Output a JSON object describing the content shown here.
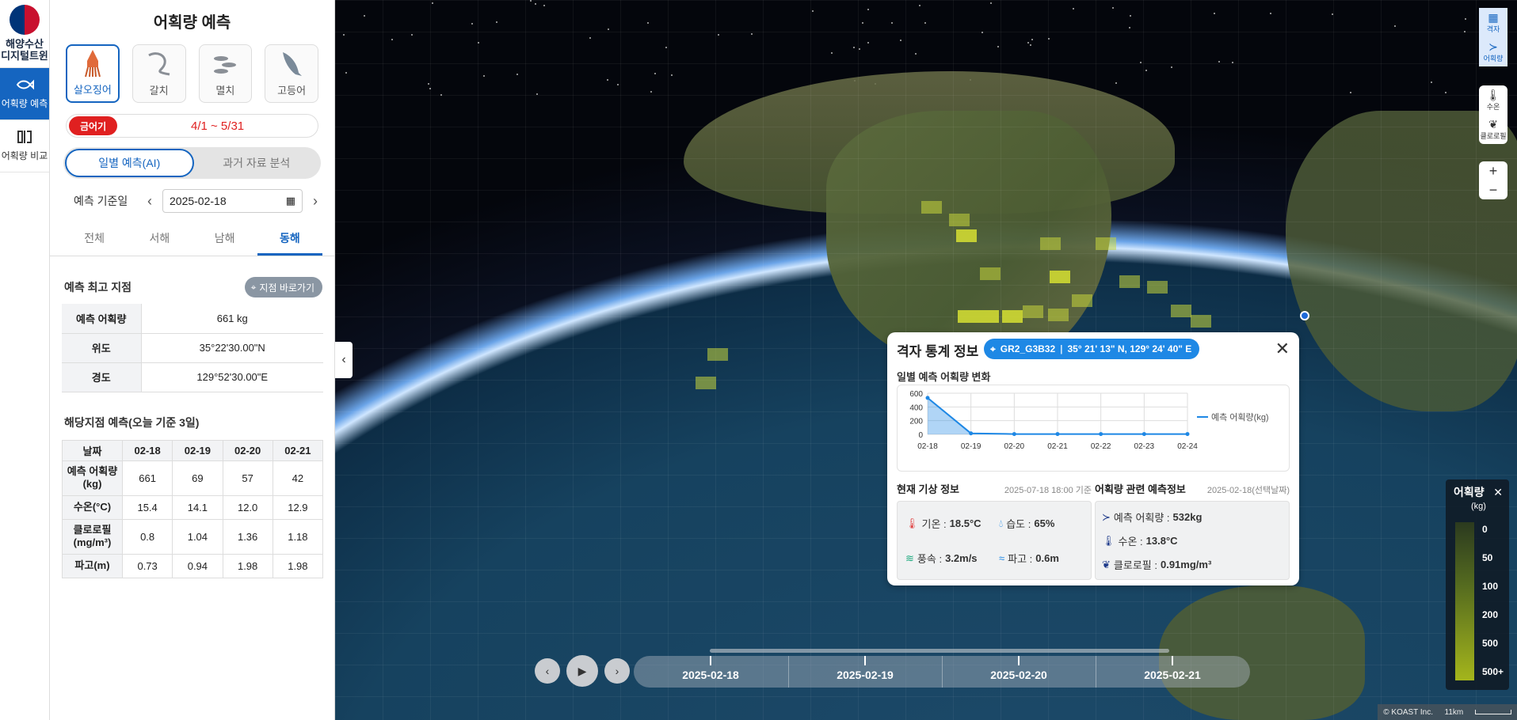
{
  "rail": {
    "logo_text": "해양수산\n디지털트윈",
    "items": [
      {
        "label": "어획량 예측",
        "icon": "fish-icon"
      },
      {
        "label": "어획량 비교",
        "icon": "compare-icon"
      }
    ]
  },
  "panel": {
    "title": "어획량 예측",
    "species": [
      {
        "label": "살오징어",
        "icon": "squid-icon",
        "active": true
      },
      {
        "label": "갈치",
        "icon": "hairtail-icon"
      },
      {
        "label": "멸치",
        "icon": "anchovy-icon"
      },
      {
        "label": "고등어",
        "icon": "mackerel-icon"
      }
    ],
    "ban": {
      "badge": "금어기",
      "range": "4/1 ~ 5/31"
    },
    "modes": [
      "일별 예측(AI)",
      "과거 자료 분석"
    ],
    "date_label": "예측 기준일",
    "date_value": "2025-02-18",
    "regions": [
      "전체",
      "서해",
      "남해",
      "동해"
    ],
    "best": {
      "heading": "예측 최고 지점",
      "goto": "지점 바로가기",
      "rows": [
        {
          "k": "예측 어획량",
          "v": "661 kg"
        },
        {
          "k": "위도",
          "v": "35°22'30.00\"N"
        },
        {
          "k": "경도",
          "v": "129°52'30.00\"E"
        }
      ]
    },
    "three": {
      "heading": "해당지점 예측(오늘 기준 3일)",
      "cols": [
        "날짜",
        "02-18",
        "02-19",
        "02-20",
        "02-21"
      ],
      "rows": [
        {
          "k": "예측 어획량\n(kg)",
          "v": [
            "661",
            "69",
            "57",
            "42"
          ]
        },
        {
          "k": "수온(°C)",
          "v": [
            "15.4",
            "14.1",
            "12.0",
            "12.9"
          ]
        },
        {
          "k": "클로로필\n(mg/m³)",
          "v": [
            "0.8",
            "1.04",
            "1.36",
            "1.18"
          ]
        },
        {
          "k": "파고(m)",
          "v": [
            "0.73",
            "0.94",
            "1.98",
            "1.98"
          ]
        }
      ]
    }
  },
  "popup": {
    "title": "격자 통계 정보",
    "grid_id": "GR2_G3B32",
    "coord": "35° 21' 13\" N, 129° 24' 40\" E",
    "chart_title": "일별 예측 어획량 변화",
    "weather": {
      "title": "현재 기상 정보",
      "time": "2025-07-18 18:00 기준",
      "temp": {
        "label": "기온 :",
        "value": "18.5°C"
      },
      "humid": {
        "label": "습도 :",
        "value": "65%"
      },
      "wind": {
        "label": "풍속 :",
        "value": "3.2m/s"
      },
      "wave": {
        "label": "파고 :",
        "value": "0.6m"
      }
    },
    "forecast": {
      "title": "어획량 관련 예측정보",
      "date": "2025-02-18(선택날짜)",
      "catch": {
        "label": "예측 어획량 :",
        "value": "532kg"
      },
      "sst": {
        "label": "수온 :",
        "value": "13.8°C"
      },
      "chl": {
        "label": "클로로필 :",
        "value": "0.91mg/m³"
      }
    }
  },
  "chart_data": {
    "type": "area",
    "title": "일별 예측 어획량 변화",
    "categories": [
      "02-18",
      "02-19",
      "02-20",
      "02-21",
      "02-22",
      "02-23",
      "02-24"
    ],
    "series": [
      {
        "name": "예측 어획량(kg)",
        "values": [
          532,
          15,
          5,
          5,
          5,
          5,
          5
        ]
      }
    ],
    "yticks": [
      "600",
      "400",
      "200",
      "0"
    ],
    "ylim": [
      0,
      600
    ],
    "grid": true,
    "legend": "right",
    "color": "#1e88e5"
  },
  "toolbar": {
    "layers": [
      {
        "label": "격자",
        "active": true
      },
      {
        "label": "어획량",
        "active": true
      }
    ],
    "env": [
      {
        "label": "수온"
      },
      {
        "label": "클로로필"
      }
    ],
    "zoom_in": "+",
    "zoom_out": "−"
  },
  "legend": {
    "title": "어획량",
    "unit": "(kg)",
    "levels": [
      "0",
      "50",
      "100",
      "200",
      "500",
      "500+"
    ]
  },
  "timeline": {
    "dates": [
      "2025-02-18",
      "2025-02-19",
      "2025-02-20",
      "2025-02-21"
    ]
  },
  "credit": {
    "text": "© KOAST Inc.",
    "scale": "11km"
  }
}
